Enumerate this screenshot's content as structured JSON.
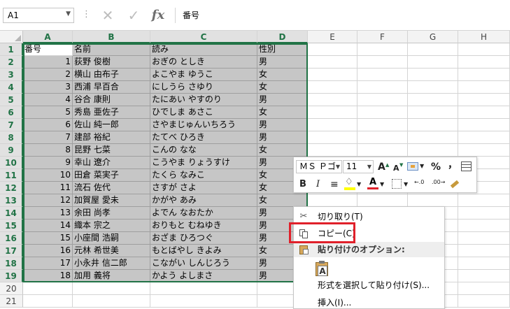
{
  "formula_bar": {
    "cell_ref": "A1",
    "dots": "⋮",
    "cancel_glyph": "✕",
    "enter_glyph": "✓",
    "fx_label": "fx",
    "content": "番号"
  },
  "columns": [
    "A",
    "B",
    "C",
    "D",
    "E",
    "F",
    "G",
    "H"
  ],
  "rows": [
    [
      "番号",
      "名前",
      "読み",
      "性別"
    ],
    [
      "1",
      "荻野 俊樹",
      "おぎの としき",
      "男"
    ],
    [
      "2",
      "横山 由布子",
      "よこやま ゆうこ",
      "女"
    ],
    [
      "3",
      "西浦 早百合",
      "にしうら さゆり",
      "女"
    ],
    [
      "4",
      "谷合 康則",
      "たにあい やすのり",
      "男"
    ],
    [
      "5",
      "秀島 亜佐子",
      "ひでしま あさこ",
      "女"
    ],
    [
      "6",
      "佐山 純一郎",
      "さやまじゅんいちろう",
      "男"
    ],
    [
      "7",
      "建部 裕紀",
      "たてべ ひろき",
      "男"
    ],
    [
      "8",
      "昆野 七菜",
      "こんの なな",
      "女"
    ],
    [
      "9",
      "幸山 遼介",
      "こうやま りょうすけ",
      "男"
    ],
    [
      "10",
      "田倉 菜実子",
      "たくら なみこ",
      "女"
    ],
    [
      "11",
      "流石 佐代",
      "さすが さよ",
      "女"
    ],
    [
      "12",
      "加賀屋 愛未",
      "かがや あみ",
      "女"
    ],
    [
      "13",
      "余田 尚孝",
      "よでん なおたか",
      "男"
    ],
    [
      "14",
      "織本 宗之",
      "おりもと むねゆき",
      "男"
    ],
    [
      "15",
      "小座間 浩嗣",
      "おざま ひろつぐ",
      "男"
    ],
    [
      "16",
      "元林 希世美",
      "もとばやし きよみ",
      "女"
    ],
    [
      "17",
      "小永井 信二郎",
      "こながい しんじろう",
      "男"
    ],
    [
      "18",
      "加用 義将",
      "かよう よしまさ",
      "男"
    ]
  ],
  "mini_toolbar": {
    "font_name": "ＭＳ Ｐゴ",
    "font_size": "11",
    "grow_font": "A",
    "shrink_font": "A",
    "percent": "%",
    "comma": "，",
    "bold": "B",
    "italic": "I",
    "center": "≡",
    "font_color_letter": "A",
    "inc_decimal": "←.0",
    "dec_decimal": ".00→",
    "accent_color": "#217346",
    "font_color": "#e0202a",
    "fill_color": "#ffff00"
  },
  "context_menu": {
    "cut": "切り取り(T)",
    "copy": "コピー(C)",
    "paste_options": "貼り付けのオプション:",
    "paste_special": "形式を選択して貼り付け(S)...",
    "insert": "挿入(I)..."
  },
  "highlight_color": "#e0202a"
}
